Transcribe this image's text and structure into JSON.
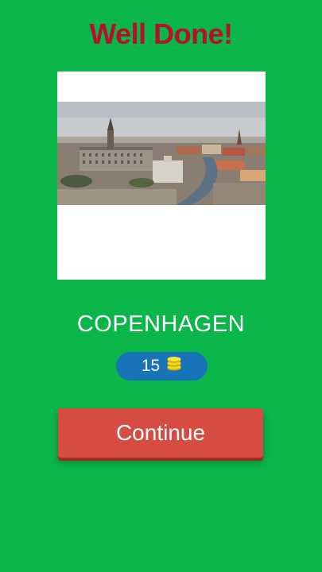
{
  "header": {
    "title": "Well Done!"
  },
  "photo": {
    "subject": "Copenhagen city skyline"
  },
  "answer": {
    "city": "COPENHAGEN"
  },
  "reward": {
    "coins": "15",
    "icon": "coin-stack-icon"
  },
  "actions": {
    "continue_label": "Continue"
  },
  "colors": {
    "background": "#0ab54a",
    "title": "#b5122a",
    "coin_pill": "#1774b6",
    "continue_button": "#d64c43"
  }
}
